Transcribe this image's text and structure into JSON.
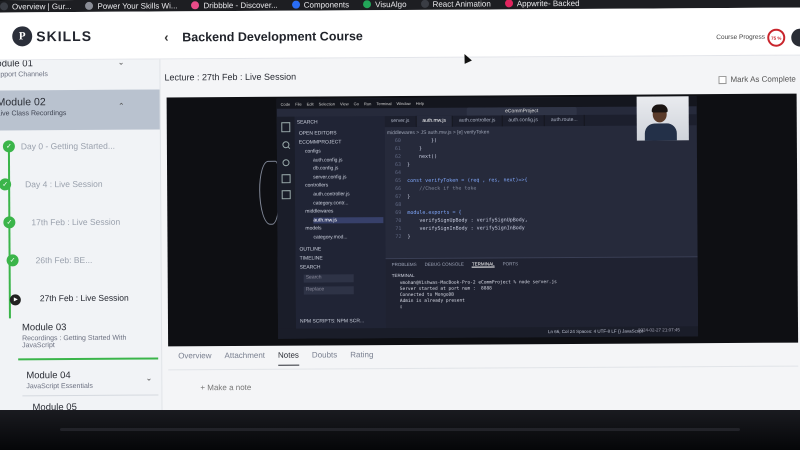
{
  "bookmarks": [
    {
      "label": "Overview | Gur...",
      "icon": "overview-icon"
    },
    {
      "label": "Power Your Skills Wi...",
      "icon": "globe-icon"
    },
    {
      "label": "Dribbble - Discover...",
      "icon": "dribbble-icon"
    },
    {
      "label": "Components",
      "icon": "components-icon"
    },
    {
      "label": "VisuAlgo",
      "icon": "visualgo-icon"
    },
    {
      "label": "React Animation",
      "icon": "react-icon"
    },
    {
      "label": "Appwrite- Backed",
      "icon": "appwrite-icon"
    }
  ],
  "header": {
    "logo_mark": "P",
    "logo_text": "SKILLS",
    "back_icon": "‹",
    "course_title": "Backend Development Course",
    "progress_label": "Course Progress",
    "progress_value": "75 %",
    "progress_percent": 75
  },
  "sidebar": {
    "module01": {
      "title": "odule 01",
      "subtitle": "upport Channels",
      "chevron": "⌄"
    },
    "module02": {
      "title": "Module 02",
      "subtitle": "Live Class Recordings",
      "chevron": "⌃"
    },
    "lessons": [
      {
        "label": "Day 0 - Getting Started...",
        "state": "completed"
      },
      {
        "label": "Day 4 : Live Session",
        "state": "completed"
      },
      {
        "label": "17th Feb : Live Session",
        "state": "completed"
      },
      {
        "label": "26th Feb: BE...",
        "state": "completed"
      },
      {
        "label": "27th Feb : Live Session",
        "state": "current"
      }
    ],
    "module03": {
      "title": "Module 03",
      "subtitle": "Recordings : Getting Started With JavaScript",
      "chevron": "⌄"
    },
    "module04": {
      "title": "Module 04",
      "subtitle": "JavaScript Essentials",
      "chevron": "⌄"
    },
    "module05": {
      "title": "Module 05"
    }
  },
  "main": {
    "lecture_title": "Lecture : 27th Feb : Live Session",
    "mark_complete": "Mark As Complete",
    "tabs": [
      "Overview",
      "Attachment",
      "Notes",
      "Doubts",
      "Rating"
    ],
    "active_tab": "Notes",
    "make_note": "+  Make a note"
  },
  "vscode": {
    "menu": [
      "Code",
      "File",
      "Edit",
      "Selection",
      "View",
      "Go",
      "Run",
      "Terminal",
      "Window",
      "Help"
    ],
    "search": "eCommProject",
    "explorer": {
      "search_label": "SEARCH",
      "open_editors": "OPEN EDITORS",
      "project": "ECOMMPROJECT",
      "items": [
        "configs",
        "auth.config.js",
        "db.config.js",
        "server.config.js",
        "controllers",
        "auth.controller.js",
        "category.contr...",
        "middlewares",
        "auth.mw.js",
        "models",
        "category.mod..."
      ],
      "outline": "OUTLINE",
      "timeline": "TIMELINE",
      "search_section": "SEARCH",
      "search_placeholder": "Search",
      "replace_placeholder": "Replace",
      "npm": "NPM SCRIPTS: NPM SCR...",
      "branch": "main*"
    },
    "tabs": [
      "server.js",
      "auth.mw.js",
      "auth.controller.js",
      "auth.config.js",
      "auth.route..."
    ],
    "active_tab": "auth.mw.js",
    "breadcrumb": "middlewares  >  JS auth.mw.js  >  [e] verifyToken",
    "code": [
      {
        "n": "60",
        "t": "        })"
      },
      {
        "n": "61",
        "t": "    }"
      },
      {
        "n": "62",
        "t": "    next()"
      },
      {
        "n": "63",
        "t": "}"
      },
      {
        "n": "64",
        "t": ""
      },
      {
        "n": "65",
        "t": "const verifyToken = (req , res, next)=>{"
      },
      {
        "n": "66",
        "t": "    //Check if the toke"
      },
      {
        "n": "67",
        "t": "}"
      },
      {
        "n": "68",
        "t": ""
      },
      {
        "n": "69",
        "t": "module.exports = {"
      },
      {
        "n": "70",
        "t": "    verifySignUpBody : verifySignUpBody,"
      },
      {
        "n": "71",
        "t": "    verifySignInBody : verifySignInBody"
      },
      {
        "n": "72",
        "t": "}"
      }
    ],
    "panel_tabs": [
      "PROBLEMS",
      "DEBUG CONSOLE",
      "TERMINAL",
      "PORTS"
    ],
    "panel_active": "TERMINAL",
    "terminal_title": "TERMINAL",
    "terminal": "vmohan@Vishwas-MacBook-Pro-2 eCommProject % node server.js\nServer started at port num :  8888\nConnected to MongoDB\nAdmin is already present\n▯",
    "status": "Ln 66, Col 24   Spaces: 4   UTF-8   LF   {} JavaScript",
    "time": "2024-02-27  21:07:45"
  }
}
